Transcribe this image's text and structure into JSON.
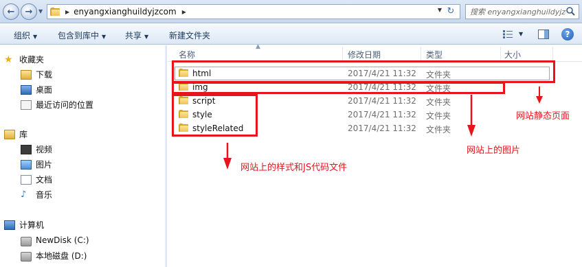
{
  "address": {
    "crumb": "enyangxianghuildyjzcom",
    "search_placeholder": "搜索 enyangxianghuildyjzcom"
  },
  "toolbar": {
    "organize": "组织",
    "include_in_library": "包含到库中",
    "share": "共享",
    "new_folder": "新建文件夹"
  },
  "nav": {
    "favorites": "收藏夹",
    "downloads": "下载",
    "desktop": "桌面",
    "recent": "最近访问的位置",
    "libraries": "库",
    "videos": "视频",
    "pictures": "图片",
    "documents": "文档",
    "music": "音乐",
    "computer": "计算机",
    "disk_c": "NewDisk (C:)",
    "disk_d": "本地磁盘 (D:)"
  },
  "columns": {
    "name": "名称",
    "modified": "修改日期",
    "type": "类型",
    "size": "大小"
  },
  "files": [
    {
      "name": "html",
      "modified": "2017/4/21 11:32",
      "type": "文件夹"
    },
    {
      "name": "img",
      "modified": "2017/4/21 11:32",
      "type": "文件夹"
    },
    {
      "name": "script",
      "modified": "2017/4/21 11:32",
      "type": "文件夹"
    },
    {
      "name": "style",
      "modified": "2017/4/21 11:32",
      "type": "文件夹"
    },
    {
      "name": "styleRelated",
      "modified": "2017/4/21 11:32",
      "type": "文件夹"
    }
  ],
  "annotations": {
    "static_pages": "网站静态页面",
    "images": "网站上的图片",
    "styles_js": "网站上的样式和JS代码文件",
    "color": "#e8141c"
  }
}
